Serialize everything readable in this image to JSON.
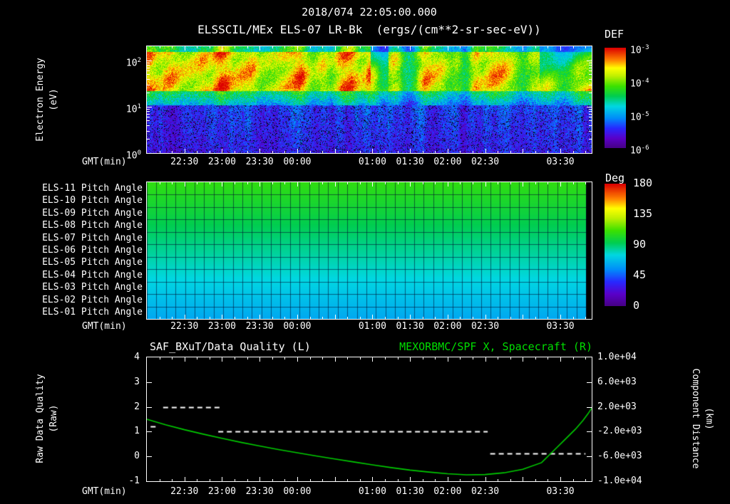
{
  "header": {
    "timestamp": "2018/074 22:05:00.000"
  },
  "colors": {
    "background": "#000000",
    "text": "#ffffff",
    "green_title": "#00dd00",
    "curve_green": "#00cc00",
    "grid": "#001a33"
  },
  "time_axis": {
    "label": "GMT(min)",
    "duration_min": 355,
    "minor_step_min": 10,
    "major_step_min": 30,
    "labeled_ticks": [
      {
        "min": 30,
        "label": "22:30"
      },
      {
        "min": 60,
        "label": "23:00"
      },
      {
        "min": 90,
        "label": "23:30"
      },
      {
        "min": 120,
        "label": "00:00"
      },
      {
        "min": 180,
        "label": "01:00"
      },
      {
        "min": 210,
        "label": "01:30"
      },
      {
        "min": 240,
        "label": "02:00"
      },
      {
        "min": 270,
        "label": "02:30"
      },
      {
        "min": 330,
        "label": "03:30"
      }
    ]
  },
  "panel1": {
    "title": "ELSSCIL/MEx ELS-07 LR-Bk",
    "units": "(ergs/(cm**2-sr-sec-eV))",
    "ylabel": [
      "Electron Energy",
      "(eV)"
    ],
    "ytick_exponents": [
      2,
      1,
      0
    ],
    "colorbar": {
      "title": "DEF",
      "tick_exponents": [
        -3,
        -4,
        -5,
        -6
      ]
    }
  },
  "panel2": {
    "row_labels": [
      "ELS-11 Pitch Angle",
      "ELS-10 Pitch Angle",
      "ELS-09 Pitch Angle",
      "ELS-08 Pitch Angle",
      "ELS-07 Pitch Angle",
      "ELS-06 Pitch Angle",
      "ELS-05 Pitch Angle",
      "ELS-04 Pitch Angle",
      "ELS-03 Pitch Angle",
      "ELS-02 Pitch Angle",
      "ELS-01 Pitch Angle"
    ],
    "colorbar": {
      "title": "Deg",
      "ticks": [
        180,
        135,
        90,
        45,
        0
      ]
    }
  },
  "panel3": {
    "title_left": "SAF_BXuT/Data Quality (L)",
    "title_right": "MEXORBMC/SPF X, Spacecraft (R)",
    "ylabel_left": [
      "Raw Data Quality",
      "(Raw)"
    ],
    "ylabel_right": [
      "Component Distance",
      "(km)"
    ],
    "left_ticks": [
      4,
      3,
      2,
      1,
      0,
      -1
    ],
    "right_tick_labels": [
      "1.0e+04",
      "6.0e+03",
      "2.0e+03",
      "-2.0e+03",
      "-6.0e+03",
      "-1.0e+04"
    ]
  },
  "chart_data": [
    {
      "type": "heatmap",
      "panel": "electron-energy-spectrogram",
      "title": "ELSSCIL/MEx ELS-07 LR-Bk",
      "units": "ergs/(cm**2-sr-sec-eV)",
      "time_start": "2018/074 22:05:00.000",
      "xlabel": "GMT(min)",
      "x_tick_labels": [
        "22:30",
        "23:00",
        "23:30",
        "00:00",
        "01:00",
        "01:30",
        "02:00",
        "02:30",
        "03:30"
      ],
      "ylabel": "Electron Energy (eV)",
      "y_scale": "log",
      "y_range_eV": [
        1,
        200
      ],
      "z_label": "DEF",
      "z_scale": "log",
      "z_range": [
        1e-06,
        0.001
      ],
      "pattern_summary": "Bright green/yellow broadband electron flux between ~20 and 200 eV with intermittent red hot spots and occasional dim blue dropout columns; weak blue/purple speckled flux with black gaps below ~10 eV"
    },
    {
      "type": "heatmap",
      "panel": "pitch-angle",
      "rows": [
        "ELS-11 Pitch Angle",
        "ELS-10 Pitch Angle",
        "ELS-09 Pitch Angle",
        "ELS-08 Pitch Angle",
        "ELS-07 Pitch Angle",
        "ELS-06 Pitch Angle",
        "ELS-05 Pitch Angle",
        "ELS-04 Pitch Angle",
        "ELS-03 Pitch Angle",
        "ELS-02 Pitch Angle",
        "ELS-01 Pitch Angle"
      ],
      "row_pitch_deg": [
        108,
        103,
        99,
        94,
        90,
        85,
        81,
        76,
        71,
        67,
        62
      ],
      "z_label": "Deg",
      "z_range": [
        0,
        180
      ],
      "pattern_summary": "Pitch angle nearly constant in time for each anode, grading from green (~108 deg) at ELS-11 to cyan (~62 deg) at ELS-01, with dark grid mesh"
    },
    {
      "type": "line",
      "panel": "quality-and-distance",
      "xlabel": "GMT(min)",
      "left_axis": {
        "label": "Raw Data Quality (Raw)",
        "range": [
          -1,
          4
        ],
        "ticks": [
          4,
          3,
          2,
          1,
          0,
          -1
        ]
      },
      "right_axis": {
        "label": "Component Distance (km)",
        "range": [
          -10000,
          10000
        ],
        "ticks": [
          "1.0e+04",
          "6.0e+03",
          "2.0e+03",
          "-2.0e+03",
          "-6.0e+03",
          "-1.0e+04"
        ]
      },
      "series": [
        {
          "name": "SAF_BXuT/Data Quality (L)",
          "axis": "left",
          "color": "#ffffff",
          "style": "dashed",
          "segments": [
            {
              "value": 1.2,
              "t_min": [
                3,
                9
              ]
            },
            {
              "value": 2.0,
              "t_min": [
                13,
                58
              ]
            },
            {
              "value": 1.0,
              "t_min": [
                57,
                272
              ]
            },
            {
              "value": 0.13,
              "t_min": [
                274,
                350
              ]
            }
          ]
        },
        {
          "name": "MEXORBMC/SPF X, Spacecraft (R)",
          "axis": "right",
          "color": "#00cc00",
          "t_min": [
            0,
            15,
            30,
            45,
            60,
            75,
            90,
            105,
            120,
            135,
            150,
            165,
            180,
            195,
            210,
            225,
            240,
            255,
            270,
            285,
            300,
            315,
            325,
            335,
            342,
            348,
            352,
            355
          ],
          "raw": [
            1.5,
            1.28,
            1.08,
            0.9,
            0.73,
            0.57,
            0.42,
            0.28,
            0.15,
            0.02,
            -0.1,
            -0.22,
            -0.34,
            -0.45,
            -0.55,
            -0.63,
            -0.7,
            -0.74,
            -0.73,
            -0.66,
            -0.52,
            -0.25,
            0.25,
            0.75,
            1.1,
            1.45,
            1.72,
            1.95
          ],
          "km": [
            0,
            -880,
            -1680,
            -2400,
            -3080,
            -3720,
            -4320,
            -4880,
            -5400,
            -5920,
            -6400,
            -6880,
            -7360,
            -7800,
            -8200,
            -8520,
            -8800,
            -8960,
            -8920,
            -8640,
            -8080,
            -7000,
            -5000,
            -3000,
            -1600,
            -200,
            880,
            1800
          ]
        }
      ]
    }
  ]
}
